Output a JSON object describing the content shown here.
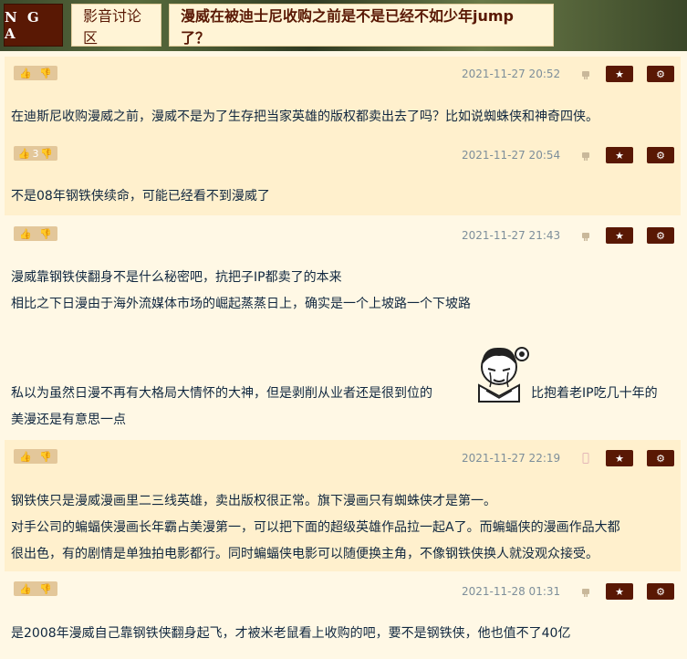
{
  "site": {
    "logo": "N G A"
  },
  "breadcrumb": {
    "forum": "影音讨论区",
    "topic": "漫威在被迪士尼收购之前是不是已经不如少年jump了？"
  },
  "icons": {
    "thumb_up": "thumbs-up-icon",
    "thumb_down": "thumbs-down-icon",
    "favorite": "star-icon",
    "options": "gear-icon",
    "device": "android-icon"
  },
  "colors": {
    "accent": "#591804",
    "vote_bg": "#e3c79a",
    "post_bg_1": "#fff0cd",
    "post_bg_2": "#fff8e5",
    "time": "#7d8e9a"
  },
  "posts": [
    {
      "votes": "",
      "time": "2021-11-27 20:52",
      "lines": [
        "在迪斯尼收购漫威之前，漫威不是为了生存把当家英雄的版权都卖出去了吗？比如说蜘蛛侠和神奇四侠。"
      ]
    },
    {
      "votes": "3",
      "time": "2021-11-27 20:54",
      "lines": [
        "不是08年钢铁侠续命，可能已经看不到漫威了"
      ]
    },
    {
      "votes": "",
      "time": "2021-11-27 21:43",
      "lines": [
        "漫威靠钢铁侠翻身不是什么秘密吧，抗把子IP都卖了的本来",
        "相比之下日漫由于海外流媒体市场的崛起蒸蒸日上，确实是一个上坡路一个下坡路",
        "私以为虽然日漫不再有大格局大情怀的大神，但是剥削从业者还是很到位的",
        "比抱着老IP吃几十年的",
        "美漫还是有意思一点"
      ]
    },
    {
      "votes": "",
      "time": "2021-11-27 22:19",
      "lines": [
        "钢铁侠只是漫威漫画里二三线英雄，卖出版权很正常。旗下漫画只有蜘蛛侠才是第一。",
        "对手公司的蝙蝠侠漫画长年霸占美漫第一，可以把下面的超级英雄作品拉一起A了。而蝙蝠侠的漫画作品大都",
        "很出色，有的剧情是单独拍电影都行。同时蝙蝠侠电影可以随便换主角，不像钢铁侠换人就没观众接受。"
      ]
    },
    {
      "votes": "",
      "time": "2021-11-28 01:31",
      "lines": [
        "是2008年漫威自己靠钢铁侠翻身起飞，才被米老鼠看上收购的吧，要不是钢铁侠，他也值不了40亿"
      ]
    }
  ]
}
